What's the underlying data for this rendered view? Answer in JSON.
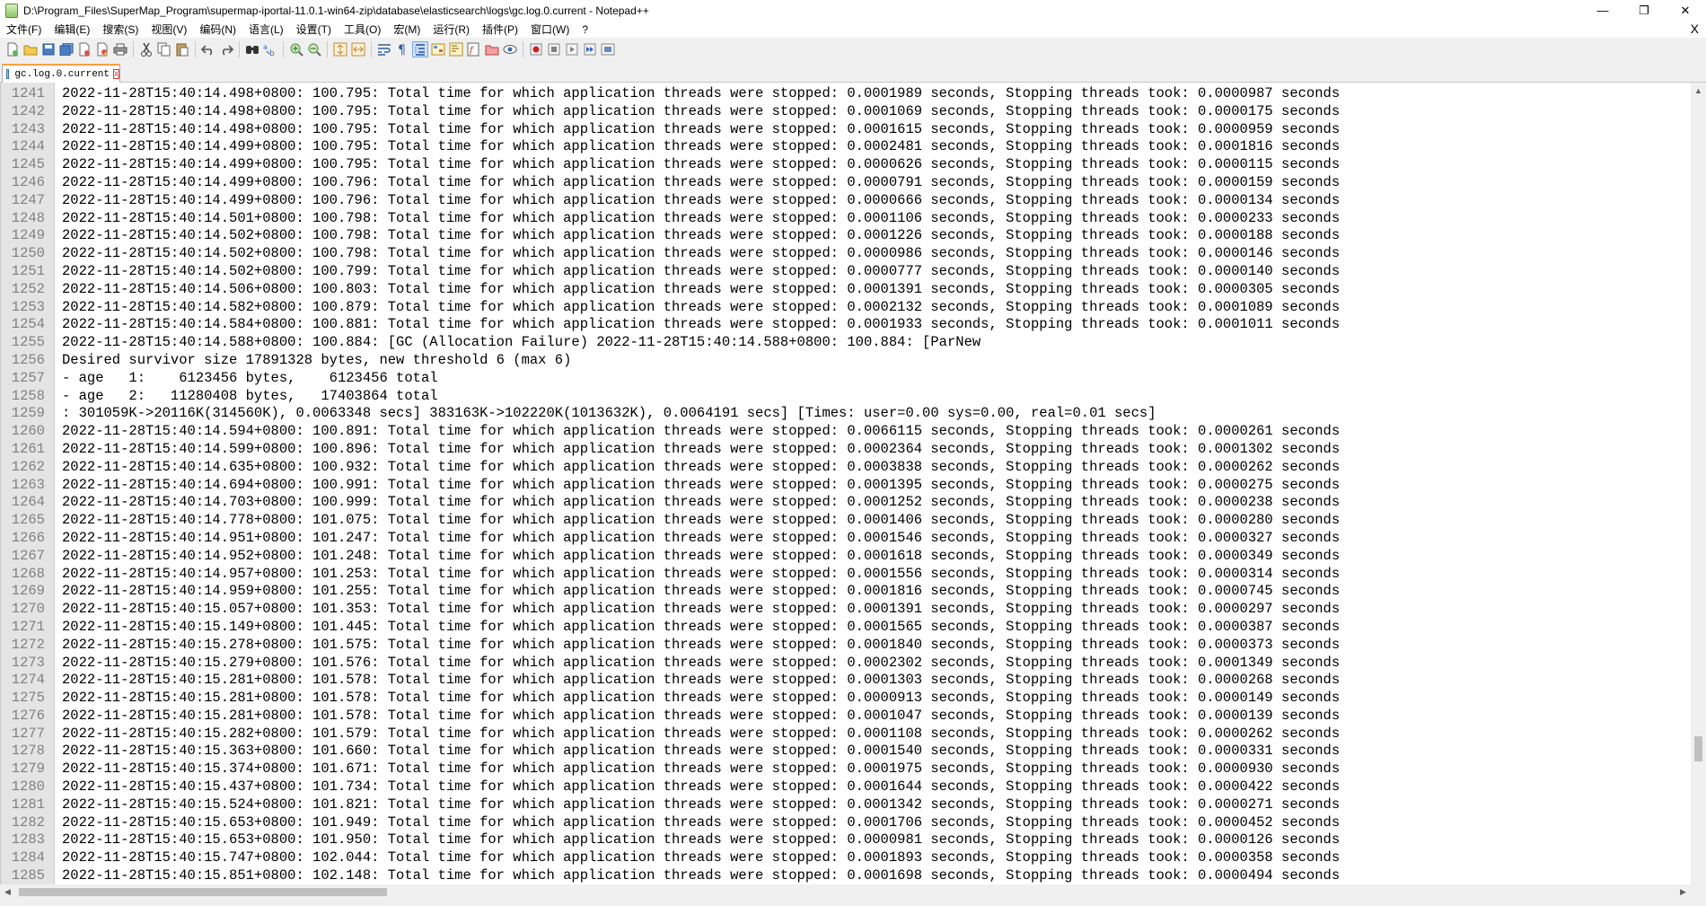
{
  "window": {
    "title": "D:\\Program_Files\\SuperMap_Program\\supermap-iportal-11.0.1-win64-zip\\database\\elasticsearch\\logs\\gc.log.0.current - Notepad++",
    "min": "—",
    "max": "❐",
    "close": "✕"
  },
  "menu": [
    "文件(F)",
    "编辑(E)",
    "搜索(S)",
    "视图(V)",
    "编码(N)",
    "语言(L)",
    "设置(T)",
    "工具(O)",
    "宏(M)",
    "运行(R)",
    "插件(P)",
    "窗口(W)",
    "?"
  ],
  "menu_close": "X",
  "tab": {
    "label": "gc.log.0.current",
    "close": "x"
  },
  "colors": {
    "tab_accent": "#f9a03f",
    "gutter": "#e4e4e4",
    "line_number": "#808080"
  },
  "lines": [
    {
      "n": "1241",
      "t": "2022-11-28T15:40:14.498+0800: 100.795: Total time for which application threads were stopped: 0.0001989 seconds, Stopping threads took: 0.0000987 seconds"
    },
    {
      "n": "1242",
      "t": "2022-11-28T15:40:14.498+0800: 100.795: Total time for which application threads were stopped: 0.0001069 seconds, Stopping threads took: 0.0000175 seconds"
    },
    {
      "n": "1243",
      "t": "2022-11-28T15:40:14.498+0800: 100.795: Total time for which application threads were stopped: 0.0001615 seconds, Stopping threads took: 0.0000959 seconds"
    },
    {
      "n": "1244",
      "t": "2022-11-28T15:40:14.499+0800: 100.795: Total time for which application threads were stopped: 0.0002481 seconds, Stopping threads took: 0.0001816 seconds"
    },
    {
      "n": "1245",
      "t": "2022-11-28T15:40:14.499+0800: 100.795: Total time for which application threads were stopped: 0.0000626 seconds, Stopping threads took: 0.0000115 seconds"
    },
    {
      "n": "1246",
      "t": "2022-11-28T15:40:14.499+0800: 100.796: Total time for which application threads were stopped: 0.0000791 seconds, Stopping threads took: 0.0000159 seconds"
    },
    {
      "n": "1247",
      "t": "2022-11-28T15:40:14.499+0800: 100.796: Total time for which application threads were stopped: 0.0000666 seconds, Stopping threads took: 0.0000134 seconds"
    },
    {
      "n": "1248",
      "t": "2022-11-28T15:40:14.501+0800: 100.798: Total time for which application threads were stopped: 0.0001106 seconds, Stopping threads took: 0.0000233 seconds"
    },
    {
      "n": "1249",
      "t": "2022-11-28T15:40:14.502+0800: 100.798: Total time for which application threads were stopped: 0.0001226 seconds, Stopping threads took: 0.0000188 seconds"
    },
    {
      "n": "1250",
      "t": "2022-11-28T15:40:14.502+0800: 100.798: Total time for which application threads were stopped: 0.0000986 seconds, Stopping threads took: 0.0000146 seconds"
    },
    {
      "n": "1251",
      "t": "2022-11-28T15:40:14.502+0800: 100.799: Total time for which application threads were stopped: 0.0000777 seconds, Stopping threads took: 0.0000140 seconds"
    },
    {
      "n": "1252",
      "t": "2022-11-28T15:40:14.506+0800: 100.803: Total time for which application threads were stopped: 0.0001391 seconds, Stopping threads took: 0.0000305 seconds"
    },
    {
      "n": "1253",
      "t": "2022-11-28T15:40:14.582+0800: 100.879: Total time for which application threads were stopped: 0.0002132 seconds, Stopping threads took: 0.0001089 seconds"
    },
    {
      "n": "1254",
      "t": "2022-11-28T15:40:14.584+0800: 100.881: Total time for which application threads were stopped: 0.0001933 seconds, Stopping threads took: 0.0001011 seconds"
    },
    {
      "n": "1255",
      "t": "2022-11-28T15:40:14.588+0800: 100.884: [GC (Allocation Failure) 2022-11-28T15:40:14.588+0800: 100.884: [ParNew"
    },
    {
      "n": "1256",
      "t": "Desired survivor size 17891328 bytes, new threshold 6 (max 6)"
    },
    {
      "n": "1257",
      "t": "- age   1:    6123456 bytes,    6123456 total"
    },
    {
      "n": "1258",
      "t": "- age   2:   11280408 bytes,   17403864 total"
    },
    {
      "n": "1259",
      "t": ": 301059K->20116K(314560K), 0.0063348 secs] 383163K->102220K(1013632K), 0.0064191 secs] [Times: user=0.00 sys=0.00, real=0.01 secs]"
    },
    {
      "n": "1260",
      "t": "2022-11-28T15:40:14.594+0800: 100.891: Total time for which application threads were stopped: 0.0066115 seconds, Stopping threads took: 0.0000261 seconds"
    },
    {
      "n": "1261",
      "t": "2022-11-28T15:40:14.599+0800: 100.896: Total time for which application threads were stopped: 0.0002364 seconds, Stopping threads took: 0.0001302 seconds"
    },
    {
      "n": "1262",
      "t": "2022-11-28T15:40:14.635+0800: 100.932: Total time for which application threads were stopped: 0.0003838 seconds, Stopping threads took: 0.0000262 seconds"
    },
    {
      "n": "1263",
      "t": "2022-11-28T15:40:14.694+0800: 100.991: Total time for which application threads were stopped: 0.0001395 seconds, Stopping threads took: 0.0000275 seconds"
    },
    {
      "n": "1264",
      "t": "2022-11-28T15:40:14.703+0800: 100.999: Total time for which application threads were stopped: 0.0001252 seconds, Stopping threads took: 0.0000238 seconds"
    },
    {
      "n": "1265",
      "t": "2022-11-28T15:40:14.778+0800: 101.075: Total time for which application threads were stopped: 0.0001406 seconds, Stopping threads took: 0.0000280 seconds"
    },
    {
      "n": "1266",
      "t": "2022-11-28T15:40:14.951+0800: 101.247: Total time for which application threads were stopped: 0.0001546 seconds, Stopping threads took: 0.0000327 seconds"
    },
    {
      "n": "1267",
      "t": "2022-11-28T15:40:14.952+0800: 101.248: Total time for which application threads were stopped: 0.0001618 seconds, Stopping threads took: 0.0000349 seconds"
    },
    {
      "n": "1268",
      "t": "2022-11-28T15:40:14.957+0800: 101.253: Total time for which application threads were stopped: 0.0001556 seconds, Stopping threads took: 0.0000314 seconds"
    },
    {
      "n": "1269",
      "t": "2022-11-28T15:40:14.959+0800: 101.255: Total time for which application threads were stopped: 0.0001816 seconds, Stopping threads took: 0.0000745 seconds"
    },
    {
      "n": "1270",
      "t": "2022-11-28T15:40:15.057+0800: 101.353: Total time for which application threads were stopped: 0.0001391 seconds, Stopping threads took: 0.0000297 seconds"
    },
    {
      "n": "1271",
      "t": "2022-11-28T15:40:15.149+0800: 101.445: Total time for which application threads were stopped: 0.0001565 seconds, Stopping threads took: 0.0000387 seconds"
    },
    {
      "n": "1272",
      "t": "2022-11-28T15:40:15.278+0800: 101.575: Total time for which application threads were stopped: 0.0001840 seconds, Stopping threads took: 0.0000373 seconds"
    },
    {
      "n": "1273",
      "t": "2022-11-28T15:40:15.279+0800: 101.576: Total time for which application threads were stopped: 0.0002302 seconds, Stopping threads took: 0.0001349 seconds"
    },
    {
      "n": "1274",
      "t": "2022-11-28T15:40:15.281+0800: 101.578: Total time for which application threads were stopped: 0.0001303 seconds, Stopping threads took: 0.0000268 seconds"
    },
    {
      "n": "1275",
      "t": "2022-11-28T15:40:15.281+0800: 101.578: Total time for which application threads were stopped: 0.0000913 seconds, Stopping threads took: 0.0000149 seconds"
    },
    {
      "n": "1276",
      "t": "2022-11-28T15:40:15.281+0800: 101.578: Total time for which application threads were stopped: 0.0001047 seconds, Stopping threads took: 0.0000139 seconds"
    },
    {
      "n": "1277",
      "t": "2022-11-28T15:40:15.282+0800: 101.579: Total time for which application threads were stopped: 0.0001108 seconds, Stopping threads took: 0.0000262 seconds"
    },
    {
      "n": "1278",
      "t": "2022-11-28T15:40:15.363+0800: 101.660: Total time for which application threads were stopped: 0.0001540 seconds, Stopping threads took: 0.0000331 seconds"
    },
    {
      "n": "1279",
      "t": "2022-11-28T15:40:15.374+0800: 101.671: Total time for which application threads were stopped: 0.0001975 seconds, Stopping threads took: 0.0000930 seconds"
    },
    {
      "n": "1280",
      "t": "2022-11-28T15:40:15.437+0800: 101.734: Total time for which application threads were stopped: 0.0001644 seconds, Stopping threads took: 0.0000422 seconds"
    },
    {
      "n": "1281",
      "t": "2022-11-28T15:40:15.524+0800: 101.821: Total time for which application threads were stopped: 0.0001342 seconds, Stopping threads took: 0.0000271 seconds"
    },
    {
      "n": "1282",
      "t": "2022-11-28T15:40:15.653+0800: 101.949: Total time for which application threads were stopped: 0.0001706 seconds, Stopping threads took: 0.0000452 seconds"
    },
    {
      "n": "1283",
      "t": "2022-11-28T15:40:15.653+0800: 101.950: Total time for which application threads were stopped: 0.0000981 seconds, Stopping threads took: 0.0000126 seconds"
    },
    {
      "n": "1284",
      "t": "2022-11-28T15:40:15.747+0800: 102.044: Total time for which application threads were stopped: 0.0001893 seconds, Stopping threads took: 0.0000358 seconds"
    },
    {
      "n": "1285",
      "t": "2022-11-28T15:40:15.851+0800: 102.148: Total time for which application threads were stopped: 0.0001698 seconds, Stopping threads took: 0.0000494 seconds"
    }
  ]
}
